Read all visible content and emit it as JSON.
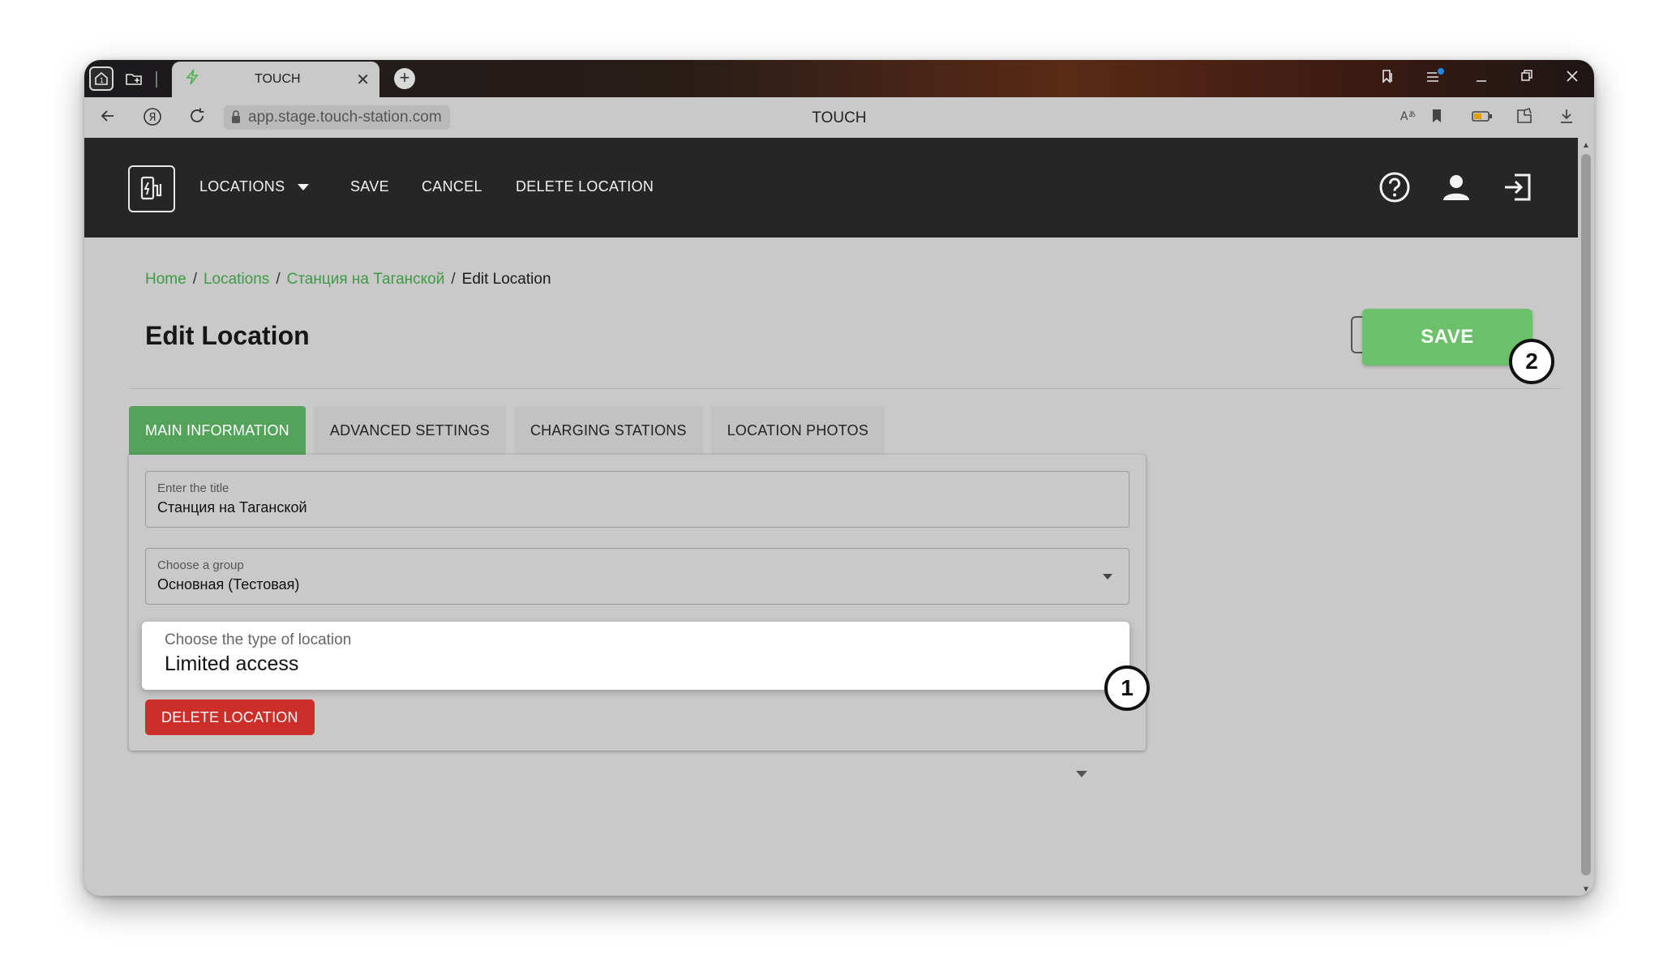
{
  "browser": {
    "tab_title": "TOUCH",
    "url": "app.stage.touch-station.com",
    "page_title": "TOUCH"
  },
  "navbar": {
    "items": [
      {
        "label": "LOCATIONS"
      },
      {
        "label": "SAVE"
      },
      {
        "label": "CANCEL"
      },
      {
        "label": "DELETE LOCATION"
      }
    ]
  },
  "breadcrumb": {
    "home": "Home",
    "locations": "Locations",
    "station": "Станция на Таганской",
    "current": "Edit Location",
    "separator": "/"
  },
  "page": {
    "title": "Edit Location",
    "save_label": "SAVE"
  },
  "tabs": [
    {
      "label": "MAIN INFORMATION",
      "active": true
    },
    {
      "label": "ADVANCED SETTINGS",
      "active": false
    },
    {
      "label": "CHARGING STATIONS",
      "active": false
    },
    {
      "label": "LOCATION PHOTOS",
      "active": false
    }
  ],
  "form": {
    "title_field": {
      "label": "Enter the title",
      "value": "Станция на Таганской"
    },
    "group_field": {
      "label": "Choose a group",
      "value": "Основная (Тестовая)"
    },
    "type_field": {
      "label": "Choose the type of location",
      "value": "Limited access"
    },
    "delete_label": "DELETE LOCATION"
  },
  "badges": {
    "type_field": "1",
    "save_button": "2"
  },
  "colors": {
    "accent_green": "#55a35a",
    "save_green": "#6cc06a",
    "danger_red": "#cc2f2a",
    "navbar_bg": "#262626"
  }
}
